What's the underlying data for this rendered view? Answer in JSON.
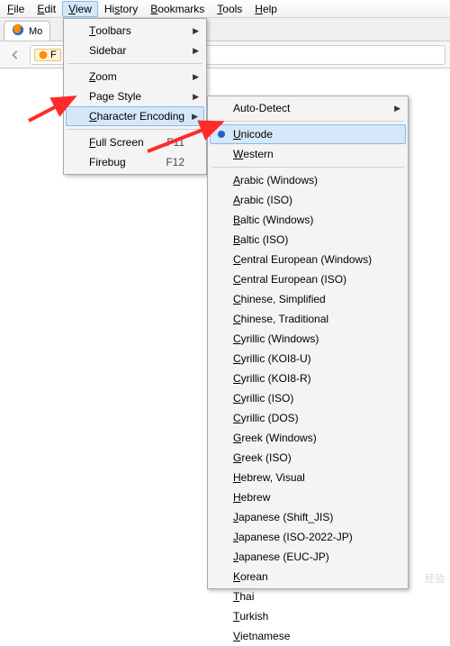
{
  "menubar": {
    "file": "File",
    "edit": "Edit",
    "view": "View",
    "history": "History",
    "bookmarks": "Bookmarks",
    "tools": "Tools",
    "help": "Help"
  },
  "tab": {
    "title": "Mo"
  },
  "url_identity": "F",
  "view_menu": {
    "toolbars": "Toolbars",
    "sidebar": "Sidebar",
    "zoom": "Zoom",
    "page_style": "Page Style",
    "encoding": "Character Encoding",
    "fullscreen": "Full Screen",
    "fullscreen_key": "F11",
    "firebug": "Firebug",
    "firebug_key": "F12"
  },
  "encoding_menu": {
    "autodetect": "Auto-Detect",
    "unicode": "Unicode",
    "western": "Western",
    "items": [
      "Arabic (Windows)",
      "Arabic (ISO)",
      "Baltic (Windows)",
      "Baltic (ISO)",
      "Central European (Windows)",
      "Central European (ISO)",
      "Chinese, Simplified",
      "Chinese, Traditional",
      "Cyrillic (Windows)",
      "Cyrillic (KOI8-U)",
      "Cyrillic (KOI8-R)",
      "Cyrillic (ISO)",
      "Cyrillic (DOS)",
      "Greek (Windows)",
      "Greek (ISO)",
      "Hebrew, Visual",
      "Hebrew",
      "Japanese (Shift_JIS)",
      "Japanese (ISO-2022-JP)",
      "Japanese (EUC-JP)",
      "Korean",
      "Thai",
      "Turkish",
      "Vietnamese"
    ]
  }
}
